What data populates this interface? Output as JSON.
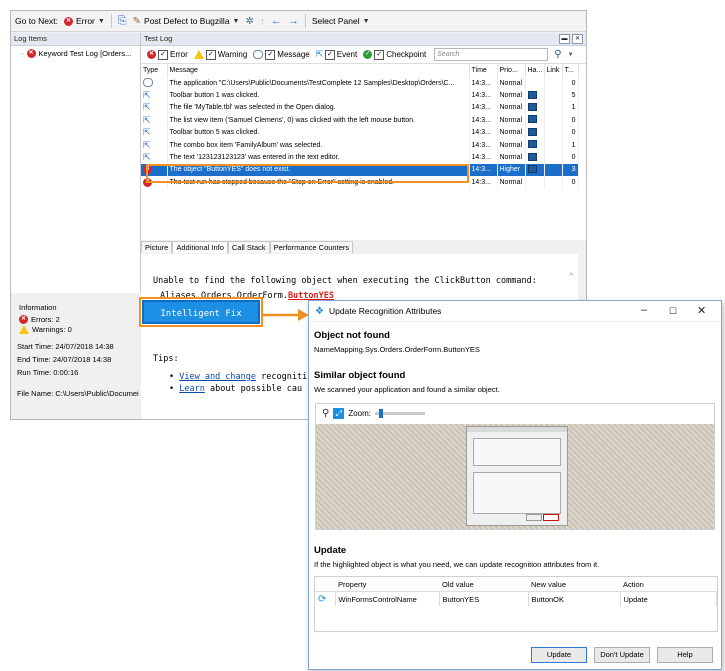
{
  "toolbar": {
    "go_next": "Go to Next:",
    "error_filter": "Error",
    "post_defect": "Post Defect to Bugzilla",
    "select_panel": "Select Panel"
  },
  "log_items": {
    "title": "Log Items",
    "item": "Keyword Test Log [Orders..."
  },
  "test_log": {
    "title": "Test Log",
    "filters": [
      "Error",
      "Warning",
      "Message",
      "Event",
      "Checkpoint"
    ],
    "search_placeholder": "Search",
    "columns": [
      "Type",
      "Message",
      "Time",
      "Prio...",
      "Ha...",
      "Link",
      "T..."
    ],
    "rows": [
      {
        "type": "info",
        "message": "The application \"C:\\Users\\Public\\Documents\\TestComplete 12 Samples\\Desktop\\Orders\\C...",
        "time": "14:3...",
        "priority": "Normal",
        "pic": false,
        "t": "0"
      },
      {
        "type": "event",
        "message": "Toolbar button 1 was clicked.",
        "time": "14:3...",
        "priority": "Normal",
        "pic": true,
        "t": "5"
      },
      {
        "type": "event",
        "message": "The file 'MyTable.tbl' was selected in the Open dialog.",
        "time": "14:3...",
        "priority": "Normal",
        "pic": true,
        "t": "1"
      },
      {
        "type": "event",
        "message": "The list view item ('Samuel Clemens', 0) was clicked with the left mouse button.",
        "time": "14:3...",
        "priority": "Normal",
        "pic": true,
        "t": "0"
      },
      {
        "type": "event",
        "message": "Toolbar button 5 was clicked.",
        "time": "14:3...",
        "priority": "Normal",
        "pic": true,
        "t": "0"
      },
      {
        "type": "event",
        "message": "The combo box item 'FamilyAlbum' was selected.",
        "time": "14:3...",
        "priority": "Normal",
        "pic": true,
        "t": "1"
      },
      {
        "type": "event",
        "message": "The text '123123123123' was entered in the text editor.",
        "time": "14:3...",
        "priority": "Normal",
        "pic": true,
        "t": "0"
      },
      {
        "type": "error",
        "message": "The object \"ButtonYES\" does not exist.",
        "time": "14:3...",
        "priority": "Higher",
        "pic": true,
        "t": "3",
        "selected": true
      },
      {
        "type": "error",
        "message": "The test run has stopped because the \"Stop on Error\" setting is enabled.",
        "time": "14:3...",
        "priority": "Normal",
        "pic": false,
        "t": "0"
      }
    ]
  },
  "details_tabs": [
    "Picture",
    "Additional Info",
    "Call Stack",
    "Performance Counters"
  ],
  "details": {
    "line1": "Unable to find the following object when executing the ClickButton command:",
    "path_prefix": "Aliases.Orders.OrderForm.",
    "path_missing": "ButtonYES",
    "fix_button": "Intelligent Fix",
    "tips_label": "Tips:",
    "tip1_link": "View and change",
    "tip1_rest": " recogniti",
    "tip2_link": "Learn",
    "tip2_rest": " about possible cau"
  },
  "info": {
    "title": "Information",
    "errors": "Errors: 2",
    "warnings": "Warnings: 0",
    "start": "Start Time: 24/07/2018 14:38",
    "end": "End Time: 24/07/2018 14:38",
    "run": "Run Time: 0:00:16",
    "file": "File Name: C:\\Users\\Public\\Documei"
  },
  "dialog": {
    "title": "Update Recognition Attributes",
    "not_found_title": "Object not found",
    "not_found_path": "NameMapping.Sys.Orders.OrderForm.ButtonYES",
    "similar_title": "Similar object found",
    "similar_text": "We scanned your application and found a similar object.",
    "zoom_label": "Zoom:",
    "update_title": "Update",
    "update_text": "If the highlighted object is what you need, we can update recognition attributes from it.",
    "table_headers": [
      "Property",
      "Old value",
      "New value",
      "Action"
    ],
    "table_row": [
      "WinFormsControlName",
      "ButtonYES",
      "ButtonOK",
      "Update"
    ],
    "buttons": {
      "update": "Update",
      "dont_update": "Don't Update",
      "help": "Help"
    }
  },
  "colors": {
    "accent": "#1a8fe3",
    "highlight": "#f39020",
    "error": "#d3262b",
    "selection": "#1b6fcb"
  }
}
